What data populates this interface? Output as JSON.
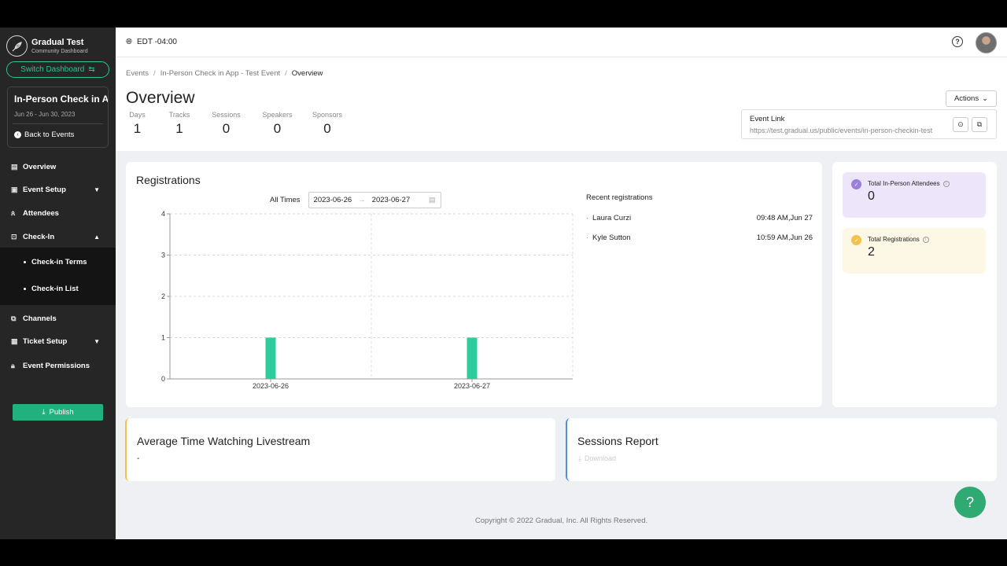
{
  "brand": {
    "name": "Gradual Test",
    "subtitle": "Community Dashboard"
  },
  "sidebar": {
    "switch_label": "Switch Dashboard",
    "event": {
      "title": "In-Person Check in Ap...",
      "dates": "Jun 26 - Jun 30, 2023",
      "back_label": "Back to Events"
    },
    "items": [
      {
        "label": "Overview",
        "icon": "overview-icon"
      },
      {
        "label": "Event Setup",
        "icon": "setup-icon"
      },
      {
        "label": "Attendees",
        "icon": "attendees-icon"
      },
      {
        "label": "Check-In",
        "icon": "checkin-icon"
      },
      {
        "label": "Channels",
        "icon": "channels-icon"
      },
      {
        "label": "Ticket Setup",
        "icon": "ticket-icon"
      },
      {
        "label": "Event Permissions",
        "icon": "lock-icon"
      }
    ],
    "subitems": [
      "Check-in Terms",
      "Check-in List"
    ],
    "publish_label": "Publish"
  },
  "topbar": {
    "timezone": "EDT -04:00"
  },
  "breadcrumb": [
    "Events",
    "In-Person Check in App - Test Event",
    "Overview"
  ],
  "page": {
    "title": "Overview",
    "stats": [
      {
        "label": "Days",
        "value": "1"
      },
      {
        "label": "Tracks",
        "value": "1"
      },
      {
        "label": "Sessions",
        "value": "0"
      },
      {
        "label": "Speakers",
        "value": "0"
      },
      {
        "label": "Sponsors",
        "value": "0"
      }
    ],
    "actions_label": "Actions",
    "event_link": {
      "label": "Event Link",
      "url": "https://test.gradual.us/public/events/in-person-checkin-test"
    }
  },
  "registrations": {
    "title": "Registrations",
    "filter_label": "All Times",
    "date_start": "2023-06-26",
    "date_end": "2023-06-27",
    "recent_title": "Recent registrations",
    "recent": [
      {
        "name": "Laura Curzi",
        "time": "09:48 AM,Jun 27"
      },
      {
        "name": "Kyle Sutton",
        "time": "10:59 AM,Jun 26"
      }
    ]
  },
  "chart_data": {
    "type": "bar",
    "categories": [
      "2023-06-26",
      "2023-06-27"
    ],
    "values": [
      1,
      1
    ],
    "ylim": [
      0,
      4
    ],
    "yticks": [
      "0",
      "1",
      "2",
      "3",
      "4"
    ],
    "grid": true,
    "bar_color": "#2ecc9a"
  },
  "summary": {
    "attendees": {
      "label": "Total In-Person Attendees",
      "value": "0",
      "color": "#ede6fa",
      "icon_color": "#9b7fd9"
    },
    "registrations": {
      "label": "Total Registrations",
      "value": "2",
      "color": "#fdf7e6",
      "icon_color": "#f2c14e"
    }
  },
  "avg_watch": {
    "title": "Average Time Watching Livestream",
    "value": "-"
  },
  "sessions_report": {
    "title": "Sessions Report",
    "download_label": "Download"
  },
  "footer": {
    "copyright": "Copyright © 2022 Gradual, Inc. All Rights Reserved."
  },
  "fab": {
    "label": "?"
  }
}
